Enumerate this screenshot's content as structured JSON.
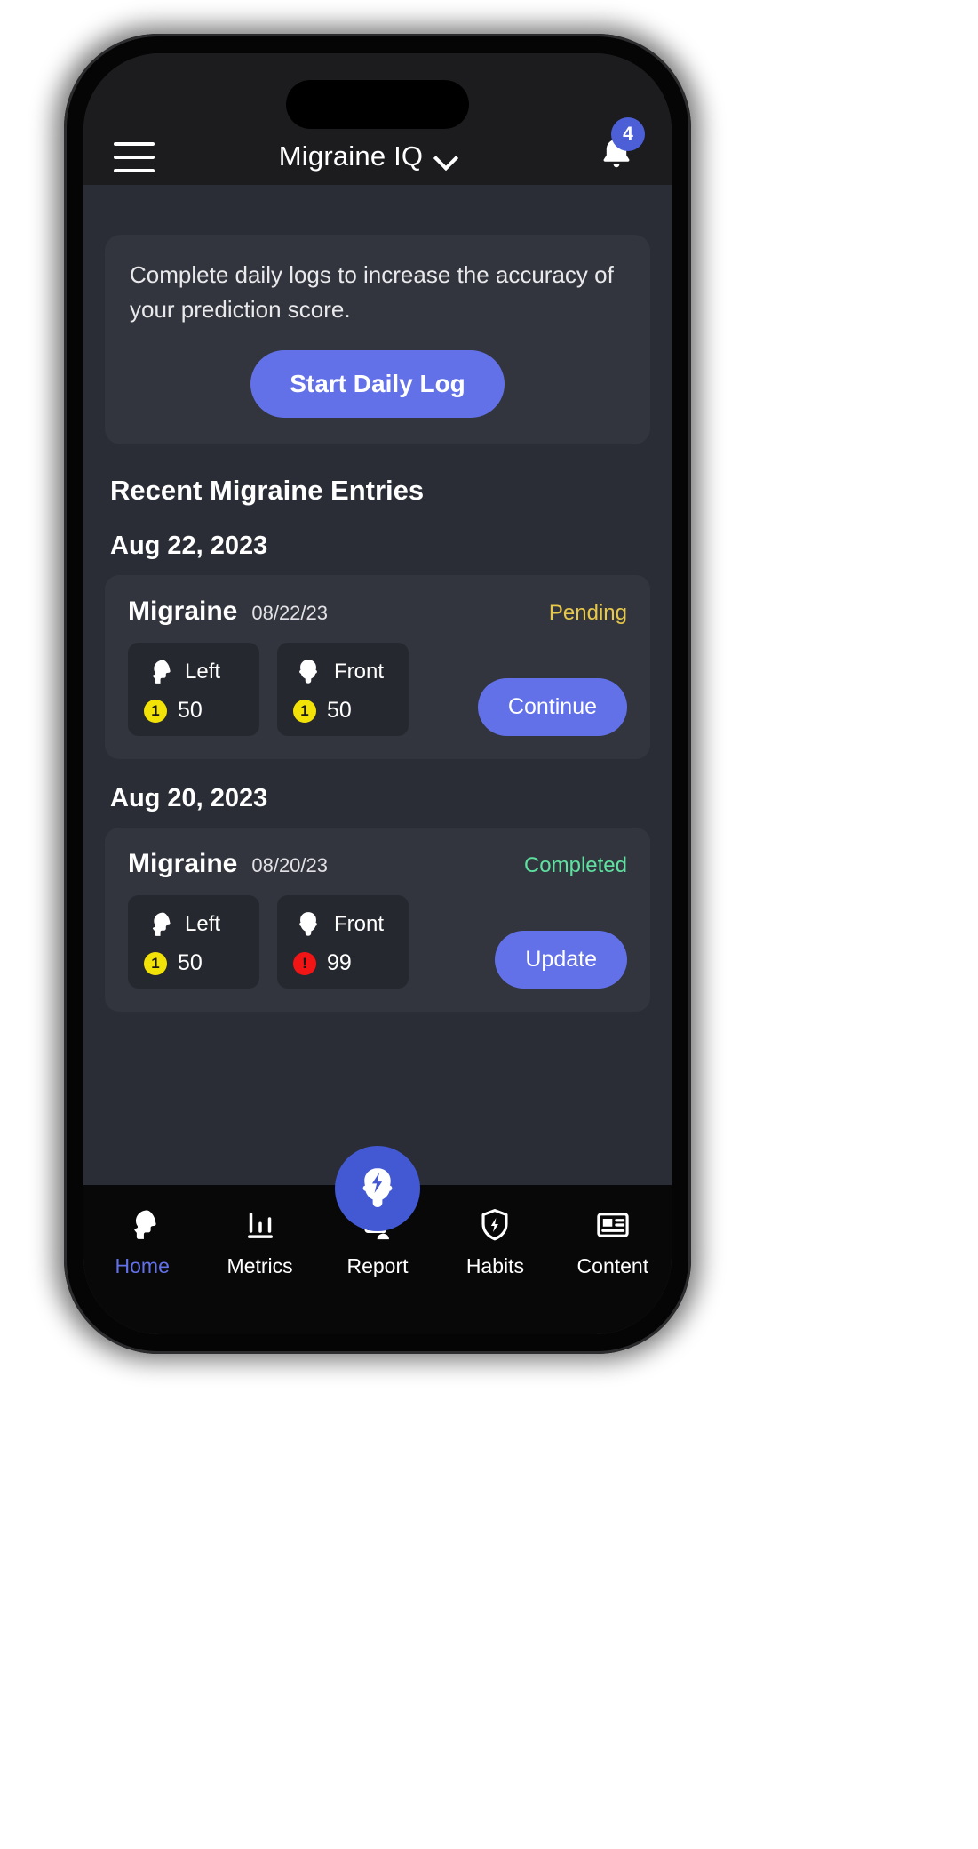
{
  "header": {
    "menu_icon": "hamburger-menu-icon",
    "title": "Migraine IQ",
    "dropdown_icon": "chevron-down-icon",
    "bell_icon": "notification-bell-icon",
    "notification_count": "4",
    "badge_color": "#4c5fd7"
  },
  "info_card": {
    "message": "Complete daily logs to increase the accuracy of your prediction score.",
    "cta_label": "Start Daily Log",
    "cta_color": "#6271e8"
  },
  "entries_section": {
    "title": "Recent Migraine Entries",
    "groups": [
      {
        "date_label": "Aug 22, 2023",
        "entry": {
          "name": "Migraine",
          "date": "08/22/23",
          "status": "Pending",
          "status_color": "#e8c84a",
          "locations": [
            {
              "icon": "head-left-profile-icon",
              "label": "Left",
              "severity_marker": "1",
              "severity_color": "#f2e207",
              "score": "50"
            },
            {
              "icon": "head-front-icon",
              "label": "Front",
              "severity_marker": "1",
              "severity_color": "#f2e207",
              "score": "50"
            }
          ],
          "action_label": "Continue"
        }
      },
      {
        "date_label": "Aug 20, 2023",
        "entry": {
          "name": "Migraine",
          "date": "08/20/23",
          "status": "Completed",
          "status_color": "#5ee0a0",
          "locations": [
            {
              "icon": "head-left-profile-icon",
              "label": "Left",
              "severity_marker": "1",
              "severity_color": "#f2e207",
              "score": "50"
            },
            {
              "icon": "head-front-icon",
              "label": "Front",
              "severity_marker": "!",
              "severity_color": "#f21515",
              "score": "99"
            }
          ],
          "action_label": "Update"
        }
      }
    ]
  },
  "fab": {
    "icon": "head-lightning-bolt-icon",
    "color": "#4359d4"
  },
  "bottom_nav": {
    "active_color": "#6271e8",
    "items": [
      {
        "icon": "head-profile-icon",
        "label": "Home",
        "active": true
      },
      {
        "icon": "bar-chart-icon",
        "label": "Metrics",
        "active": false
      },
      {
        "icon": "report-person-icon",
        "label": "Report",
        "active": false
      },
      {
        "icon": "shield-bolt-icon",
        "label": "Habits",
        "active": false
      },
      {
        "icon": "article-card-icon",
        "label": "Content",
        "active": false
      }
    ]
  }
}
